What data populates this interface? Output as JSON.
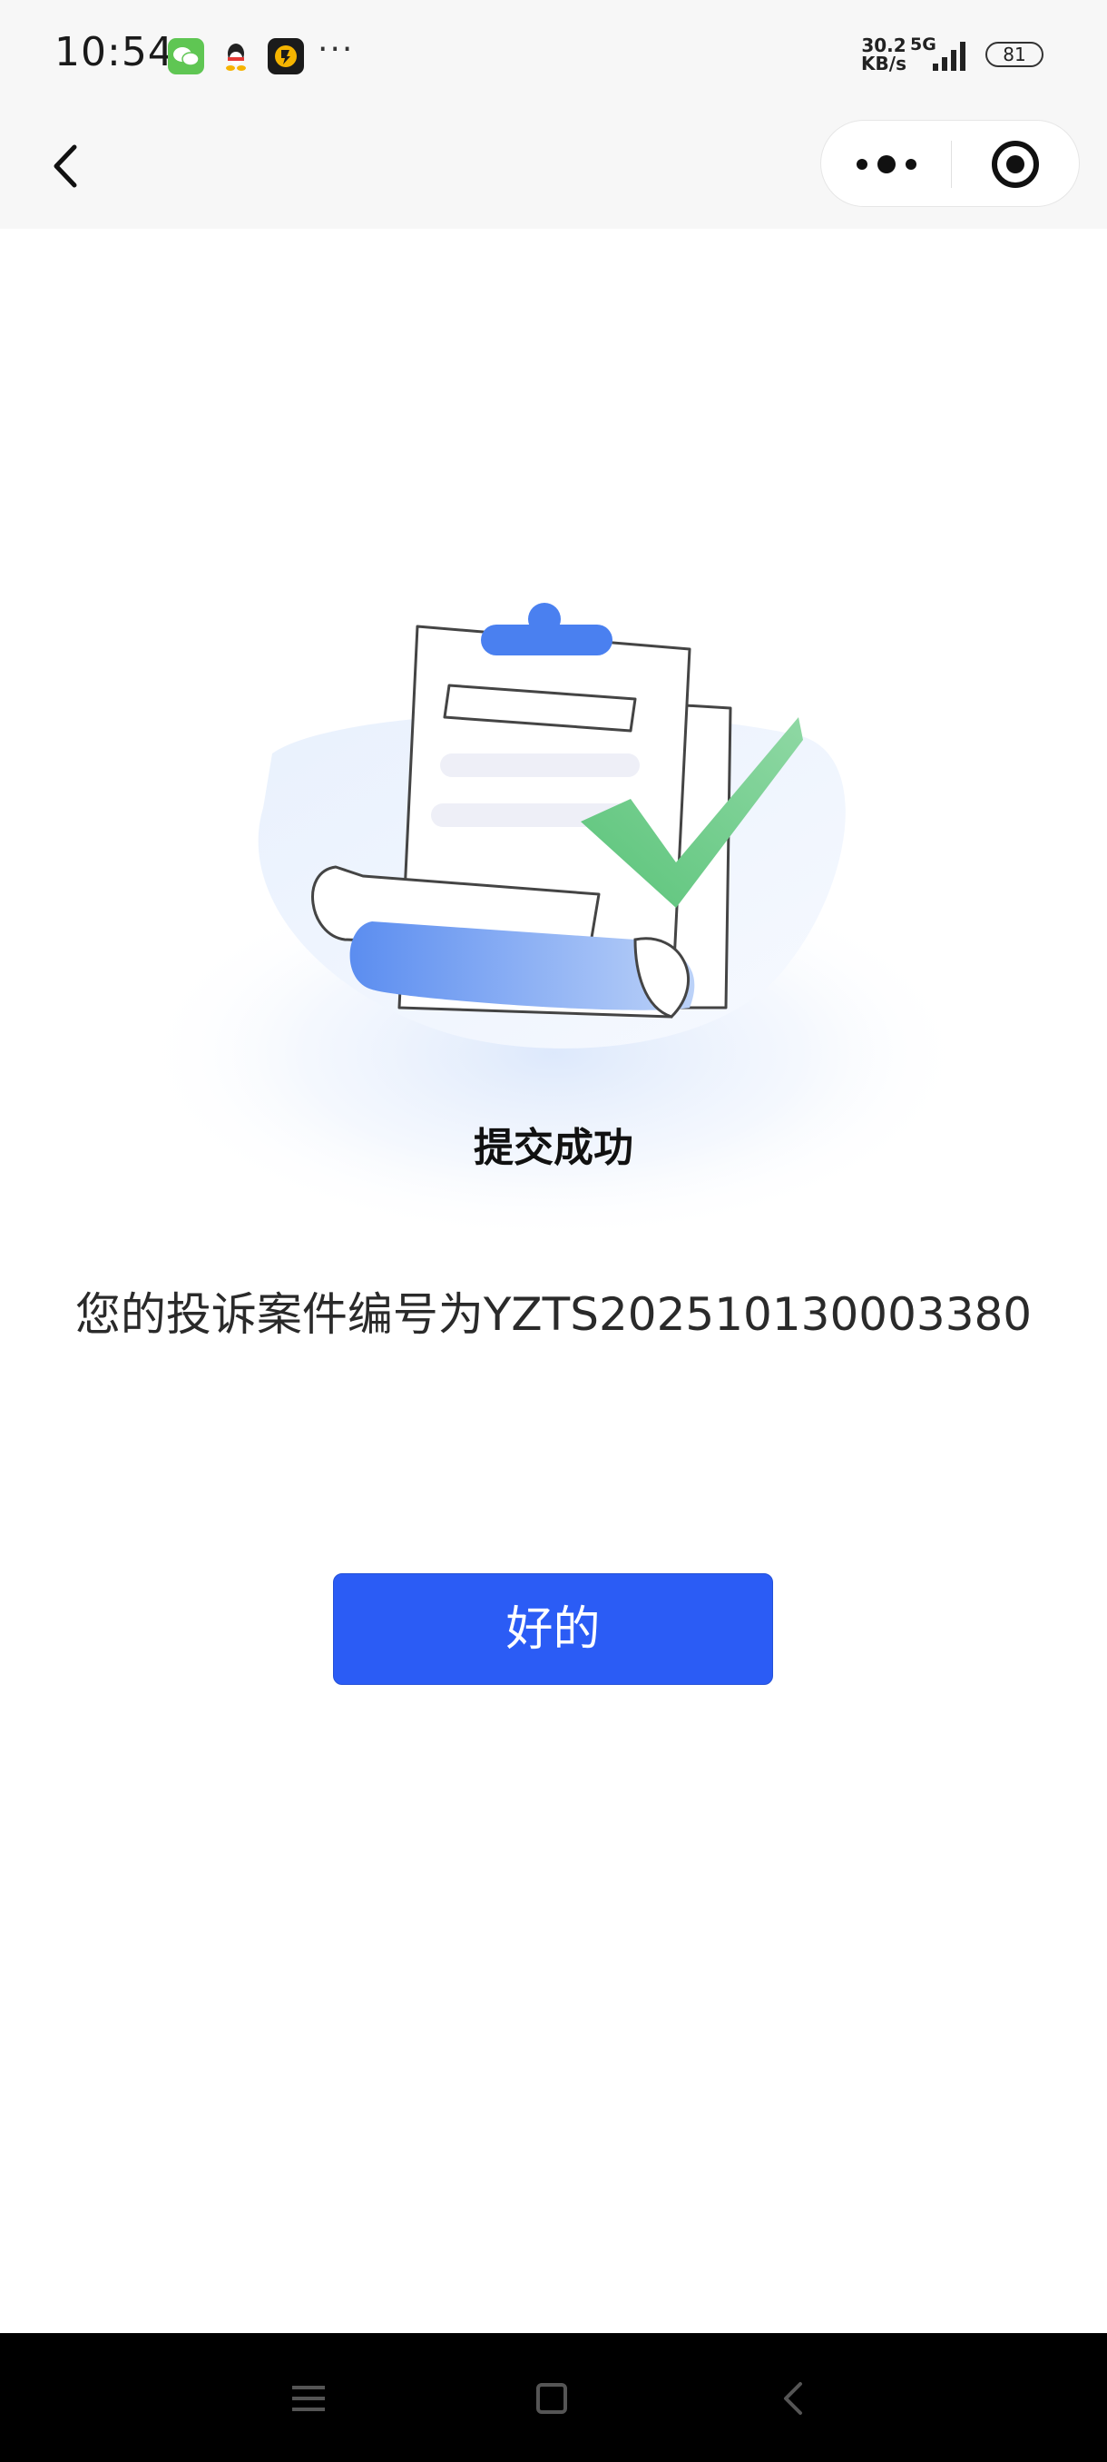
{
  "status_bar": {
    "time": "10:54",
    "net_speed_value": "30.2",
    "net_speed_unit": "KB/s",
    "network": "5G",
    "battery": "81",
    "icons": [
      "wechat-icon",
      "qq-icon",
      "app-icon",
      "more-dots-icon",
      "signal-icon",
      "battery-icon"
    ]
  },
  "nav": {
    "icons": [
      "back-arrow-icon",
      "more-icon",
      "close-target-icon"
    ]
  },
  "main": {
    "title": "提交成功",
    "case_text": "您的投诉案件编号为YZTS202510130003380",
    "ok_button": "好的"
  },
  "bottom_nav": {
    "icons": [
      "menu-icon",
      "home-square-icon",
      "back-icon"
    ]
  },
  "colors": {
    "accent": "#2b5cf5",
    "check_green": "#5bc47a",
    "clip_blue": "#4a80f0"
  }
}
